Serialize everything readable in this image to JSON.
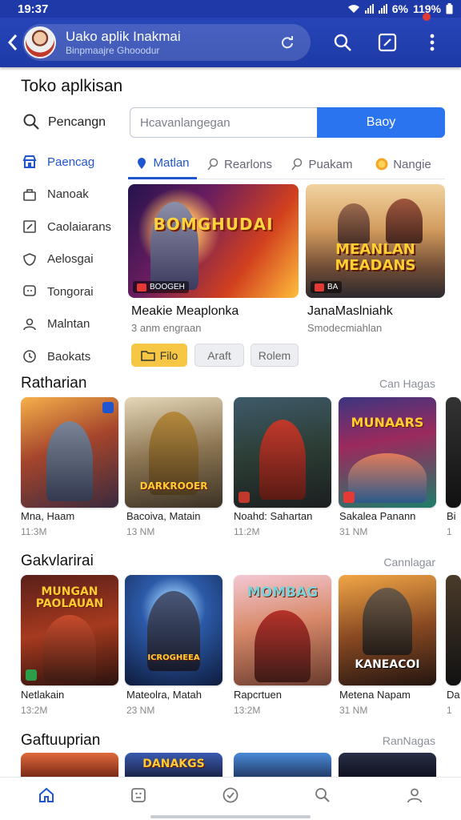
{
  "status": {
    "time": "19:37",
    "battery": "119%",
    "extra": "6%"
  },
  "header": {
    "title": "Uako aplik Inakmai",
    "subtitle": "Binpmaajre Ghooodur"
  },
  "page": {
    "title": "Toko aplkisan"
  },
  "search": {
    "label": "Pencangn",
    "placeholder": "Hcavanlangegan",
    "button": "Baoy"
  },
  "sidebar": {
    "items": [
      {
        "label": "Paencag",
        "icon": "shop-icon"
      },
      {
        "label": "Nanoak",
        "icon": "bag-icon"
      },
      {
        "label": "Caolaiarans",
        "icon": "box-icon"
      },
      {
        "label": "Aelosgai",
        "icon": "shield-icon"
      },
      {
        "label": "Tongorai",
        "icon": "chat-icon"
      },
      {
        "label": "Malntan",
        "icon": "people-icon"
      },
      {
        "label": "Baokats",
        "icon": "clock-icon"
      }
    ]
  },
  "tabs": [
    {
      "label": "Matlan",
      "icon": "pin-icon"
    },
    {
      "label": "Rearlons",
      "icon": "pin-outline-icon"
    },
    {
      "label": "Puakam",
      "icon": "pin-outline-icon"
    },
    {
      "label": "Nangie",
      "icon": "coin-icon"
    }
  ],
  "featured": [
    {
      "banner": "BOMGHUDAI",
      "tag": "BOOGEH",
      "title": "Meakie Meaplonka",
      "subtitle": "3 anm engraan"
    },
    {
      "banner": "MEANLAN MEADANS",
      "tag": "BA",
      "title": "JanaMaslniahk",
      "subtitle": "Smodecmiahlan"
    }
  ],
  "chips": [
    "Filo",
    "Araft",
    "Rolem"
  ],
  "sections": [
    {
      "title": "Ratharian",
      "more": "Can Hagas",
      "tiles": [
        {
          "name": "Mna, Haam",
          "size": "11:3M",
          "logo": ""
        },
        {
          "name": "Bacoiva, Matain",
          "size": "13 NM",
          "logo": "DARKROOER"
        },
        {
          "name": "Noahd: Sahartan",
          "size": "11:2M",
          "logo": ""
        },
        {
          "name": "Sakalea Panann",
          "size": "31 NM",
          "logo": "MUNAARS"
        },
        {
          "name": "Bi",
          "size": "1",
          "logo": ""
        }
      ]
    },
    {
      "title": "Gakvlarirai",
      "more": "Cannlagar",
      "tiles": [
        {
          "name": "Netlakain",
          "size": "13:2M",
          "logo": "MUNGAN PAOLAUAN"
        },
        {
          "name": "Mateolra, Matah",
          "size": "23 NM",
          "logo": "ICROGHEEA"
        },
        {
          "name": "Rapcrtuen",
          "size": "13:2M",
          "logo": "MOMBAG"
        },
        {
          "name": "Metena Napam",
          "size": "31 NM",
          "logo": "KANEACOI"
        },
        {
          "name": "Da",
          "size": "1",
          "logo": ""
        }
      ]
    },
    {
      "title": "Gaftuuprian",
      "more": "RanNagas",
      "tiles": [
        {
          "name": "",
          "size": "",
          "logo": ""
        },
        {
          "name": "",
          "size": "",
          "logo": "DANAKGS"
        },
        {
          "name": "",
          "size": "",
          "logo": ""
        },
        {
          "name": "",
          "size": "",
          "logo": ""
        }
      ]
    }
  ],
  "bottom_nav": [
    "home-icon",
    "apps-icon",
    "check-icon",
    "search-icon",
    "profile-icon"
  ]
}
